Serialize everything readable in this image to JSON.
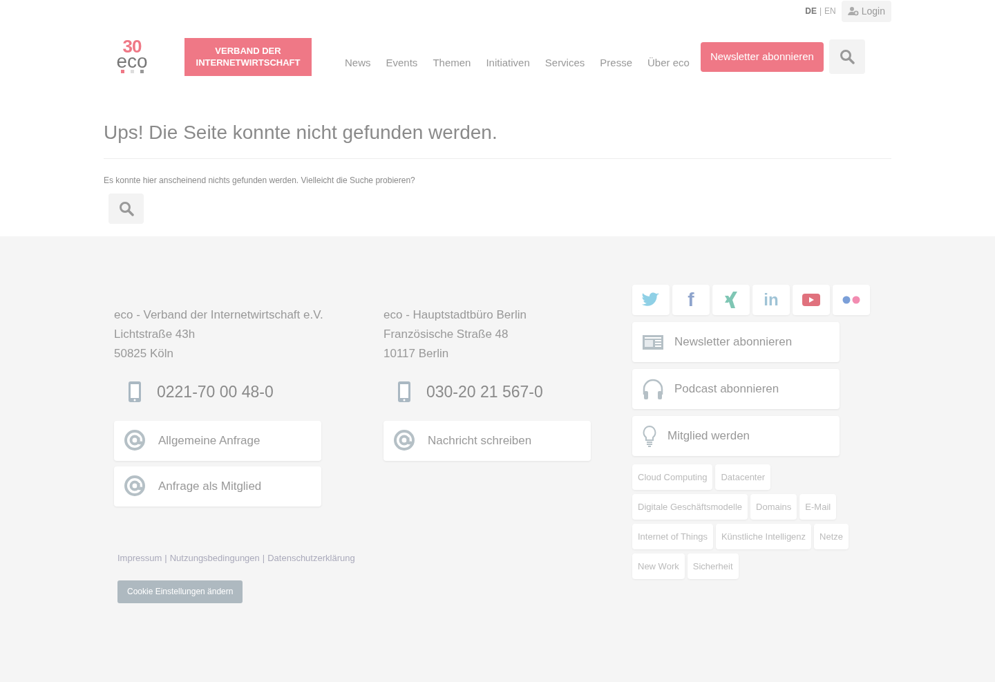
{
  "topbar": {
    "languages": [
      {
        "label": "DE",
        "selected": true
      },
      {
        "label": "EN",
        "selected": false
      }
    ],
    "separator": "|",
    "login": "Login"
  },
  "logo": {
    "number": "30",
    "word": "eco",
    "tagline": [
      "VERBAND DER",
      "INTERNETWIRTSCHAFT"
    ]
  },
  "nav": {
    "items": [
      "News",
      "Events",
      "Themen",
      "Initiativen",
      "Services",
      "Presse",
      "Über eco"
    ],
    "cta": "Newsletter abonnieren"
  },
  "main": {
    "title": "Ups! Die Seite konnte nicht gefunden werden.",
    "text": "Es konnte hier anscheinend nichts gefunden werden. Vielleicht die Suche probieren?"
  },
  "footer": {
    "offices": [
      {
        "address": [
          "eco - Verband der Internetwirtschaft e.V.",
          "Lichtstraße 43h",
          "50825 Köln"
        ],
        "phone": "0221-70 00 48-0",
        "contacts": [
          "Allgemeine Anfrage",
          "Anfrage als Mitglied"
        ]
      },
      {
        "address": [
          "eco - Hauptstadtbüro Berlin",
          "Französische Straße 48",
          "10117 Berlin"
        ],
        "phone": "030-20 21 567-0",
        "contacts": [
          "Nachricht schreiben"
        ]
      }
    ],
    "social": [
      {
        "kind": "twitter"
      },
      {
        "kind": "facebook",
        "glyph": "f"
      },
      {
        "kind": "xing"
      },
      {
        "kind": "linkedin",
        "glyph": "in"
      },
      {
        "kind": "youtube"
      },
      {
        "kind": "flickr"
      }
    ],
    "actions": [
      {
        "kind": "newsletter",
        "label": "Newsletter abonnieren"
      },
      {
        "kind": "podcast",
        "label": "Podcast abonnieren"
      },
      {
        "kind": "member",
        "label": "Mitglied werden"
      }
    ],
    "tags": [
      [
        "Cloud Computing",
        "Datacenter"
      ],
      [
        "Digitale Geschäftsmodelle",
        "Domains",
        "E-Mail"
      ],
      [
        "Internet of Things",
        "Künstliche Intelligenz",
        "Netze"
      ],
      [
        "New Work",
        "Sicherheit"
      ]
    ],
    "links": [
      "Impressum",
      "Nutzungsbedingungen",
      "Datenschutzerklärung"
    ],
    "link_separator": "|",
    "cookie": "Cookie Einstellungen ändern"
  }
}
